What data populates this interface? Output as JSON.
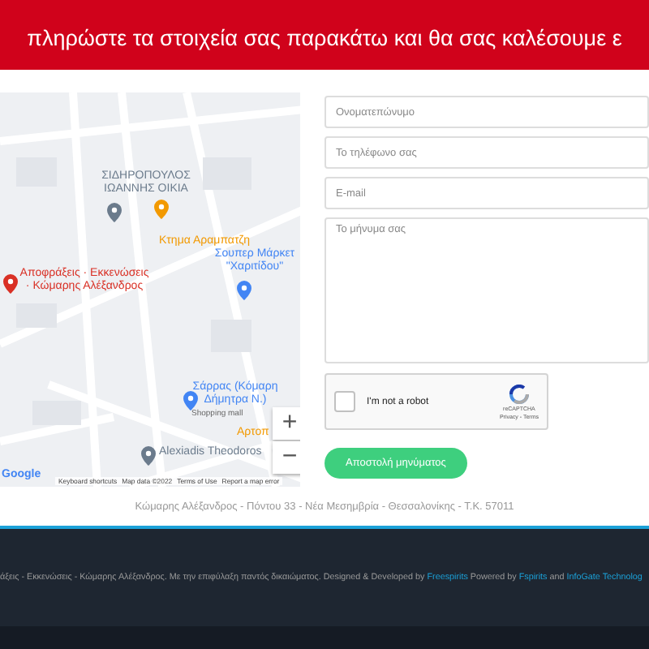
{
  "banner": {
    "text": "πληρώστε τα στοιχεία σας παρακάτω και θα σας καλέσουμε ε"
  },
  "map": {
    "places": [
      {
        "kind": "grey",
        "label": "ΣΙΔΗΡΟΠΟΥΛΟΣ ΙΩΑΝΝΗΣ ΟΙΚΙΑ"
      },
      {
        "kind": "orange",
        "label": "Κτημα Αραμπατζη"
      },
      {
        "kind": "blue",
        "label": "Σουπερ Μάρκετ \"Χαριτίδου\""
      },
      {
        "kind": "red",
        "label": "Αποφράξεις · Εκκενώσεις · Κώμαρης Αλέξανδρος"
      },
      {
        "kind": "blue",
        "label": "Σάρρας (Κόμαρη Δήμητρα Ν.)",
        "sub": "Shopping mall"
      },
      {
        "kind": "orange",
        "label": "Αρτοπ"
      },
      {
        "kind": "grey",
        "label": "Alexiadis Theodoros"
      }
    ],
    "zoom_in": "+",
    "zoom_out": "−",
    "logo": "Google",
    "attribution": [
      "Keyboard shortcuts",
      "Map data ©2022",
      "Terms of Use",
      "Report a map error"
    ]
  },
  "form": {
    "fields": [
      {
        "kind": "input",
        "placeholder": "Ονοματεπώνυμο"
      },
      {
        "kind": "input",
        "placeholder": "Το τηλέφωνο σας"
      },
      {
        "kind": "input",
        "placeholder": "E-mail"
      },
      {
        "kind": "textarea",
        "placeholder": "Το μήνυμα σας"
      }
    ],
    "captcha": {
      "label": "I'm not a robot",
      "checked": false,
      "brand": "reCAPTCHA",
      "links": "Privacy - Terms"
    },
    "submit": "Αποστολή μηνύματος"
  },
  "address": "Κώμαρης Αλέξανδρος - Πόντου 33 - Νέα Μεσημβρία - Θεσσαλονίκης - Τ.Κ. 57011",
  "footer": {
    "parts": [
      {
        "kind": "text",
        "text": "άξεις - Εκκενώσεις - Κώμαρης Αλέξανδρος. Με την επιφύλαξη παντός δικαιώματος. Designed & Developed by"
      },
      {
        "kind": "link",
        "text": "Freespirits"
      },
      {
        "kind": "text",
        "text": "Powered by"
      },
      {
        "kind": "link",
        "text": "Fspirits"
      },
      {
        "kind": "text",
        "text": "and"
      },
      {
        "kind": "link",
        "text": "InfoGate Technolog"
      }
    ]
  }
}
